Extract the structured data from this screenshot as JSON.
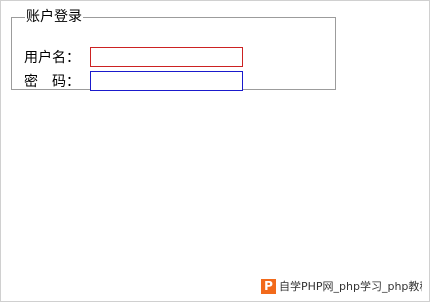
{
  "login": {
    "legend": "账户登录",
    "username_label": "用户名：",
    "password_label": "密　码：",
    "username_value": "",
    "password_value": ""
  },
  "watermark": {
    "logo_letter": "P",
    "text": "自学PHP网_php学习_php教程"
  },
  "colors": {
    "username_border": "#cc2222",
    "password_border": "#1a1acc",
    "fieldset_border": "#9c9c9c",
    "watermark_logo": "#f26a1b"
  }
}
